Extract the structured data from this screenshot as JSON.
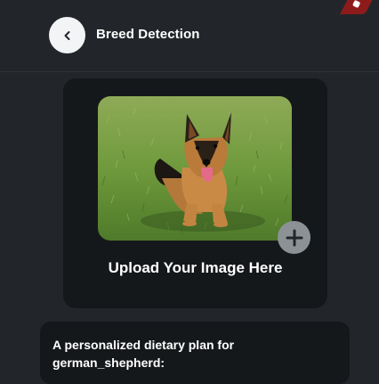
{
  "header": {
    "title": "Breed Detection",
    "back_icon": "chevron-left-icon"
  },
  "upload": {
    "label": "Upload Your Image Here",
    "add_icon": "plus-icon"
  },
  "diet": {
    "line1": "A personalized dietary plan for",
    "line2": "german_shepherd:"
  },
  "colors": {
    "background": "#22262a",
    "card": "#15181b",
    "ribbon": "#8e1b1b"
  }
}
